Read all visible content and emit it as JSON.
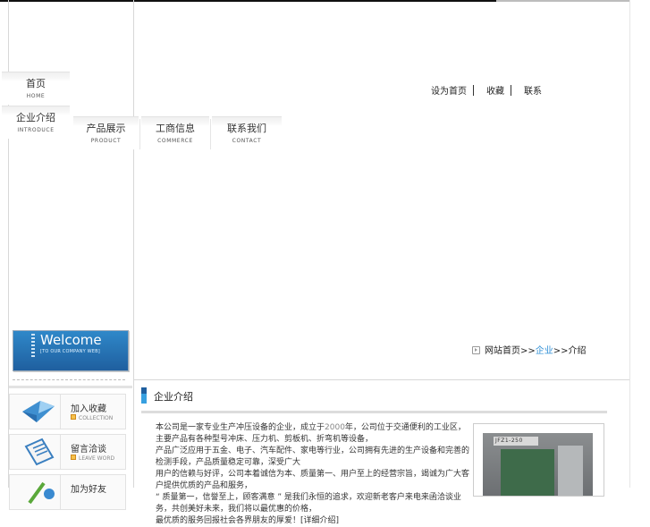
{
  "nav": {
    "tabs": [
      {
        "cn": "首页",
        "en": "HOME"
      },
      {
        "cn": "企业介绍",
        "en": "INTRODUCE"
      },
      {
        "cn": "产品展示",
        "en": "PRODUCT"
      },
      {
        "cn": "工商信息",
        "en": "COMMERCE"
      },
      {
        "cn": "联系我们",
        "en": "CONTACT"
      }
    ]
  },
  "top_links": [
    "设为首页",
    "收藏",
    "联系"
  ],
  "welcome": {
    "title": "Welcome",
    "subtitle": "[TO OUR COMPANY WEB]"
  },
  "quick_links": [
    {
      "cn": "加入收藏",
      "en": "COLLECTION",
      "icon": "envelope-icon"
    },
    {
      "cn": "留言洽谈",
      "en": "LEAVE WORD",
      "icon": "clipboard-icon"
    },
    {
      "cn": "加为好友",
      "en": "",
      "icon": "pencil-icon"
    }
  ],
  "breadcrumb": {
    "home": "网站首页",
    "sep": ">>",
    "current": "企业",
    "page": "介绍"
  },
  "section": {
    "title": "企业介绍"
  },
  "intro": {
    "line1_a": "本公司是一家专业生产冲压设备的企业，成立于",
    "year": "2000",
    "line1_b": "年，公司位于交通便利的工业区，主要产品有各种型号冲床、压力机、剪板机、折弯机等设备，",
    "line2": "产品广泛应用于五金、电子、汽车配件、家电等行业，公司拥有先进的生产设备和完善的检测手段，产品质量稳定可靠，深受广大",
    "line3": "用户的信赖与好评，公司本着诚信为本、质量第一、用户至上的经营宗旨，竭诚为广大客户提供优质的产品和服务，",
    "line4": "“ 质量第一，信誉至上，顾客满意 ” 是我们永恒的追求，欢迎新老客户来电来函洽谈业务，共创美好未来，我们将以最优惠的价格，",
    "line5": "最优质的服务回报社会各界朋友的厚爱！[详细介绍]"
  },
  "photo": {
    "label": "JFZ1-250"
  }
}
